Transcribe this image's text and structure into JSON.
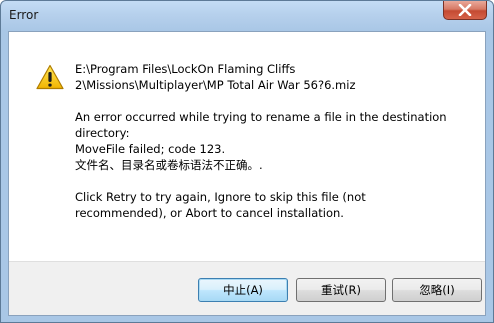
{
  "window": {
    "title": "Error"
  },
  "icons": {
    "warning": "warning-icon",
    "close": "close-icon"
  },
  "message": {
    "path": "E:\\Program Files\\LockOn Flaming Cliffs\n2\\Missions\\Multiplayer\\MP Total Air War 56?6.miz",
    "error": "An error occurred while trying to rename a file in the destination\ndirectory:\nMoveFile failed; code 123.\n文件名、目录名或卷标语法不正确。.",
    "instructions": "Click Retry to try again, Ignore to skip this file (not\nrecommended), or Abort to cancel installation."
  },
  "buttons": {
    "abort": "中止(A)",
    "retry": "重试(R)",
    "ignore": "忽略(I)"
  },
  "colors": {
    "frame": "#a9c7e6",
    "close_button": "#c44a32",
    "default_button_border": "#3c7fb1",
    "warning_yellow": "#f5c400"
  }
}
